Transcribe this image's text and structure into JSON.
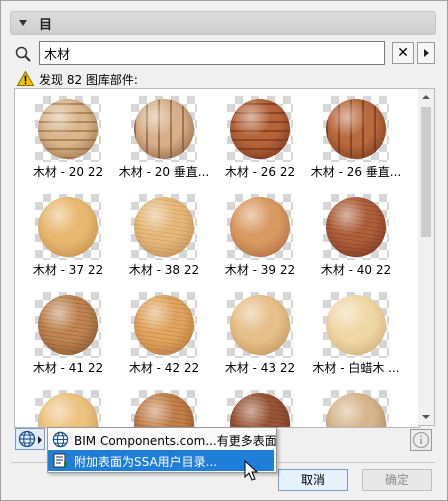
{
  "section": {
    "title": "目"
  },
  "search": {
    "value": "木材",
    "clear_label": "✕"
  },
  "status": {
    "text": "发现 82 图库部件:"
  },
  "gallery": {
    "items": [
      {
        "label": "木材 - 20 22",
        "color": "#d9b68c",
        "dark": "#8a5a32",
        "pattern": "hbands"
      },
      {
        "label": "木材 - 20 垂直...",
        "color": "#d6b089",
        "dark": "#7a4e2c",
        "pattern": "vbands"
      },
      {
        "label": "木材 - 26 22",
        "color": "#b5643a",
        "dark": "#6a2a14",
        "pattern": "hbands"
      },
      {
        "label": "木材 - 26 垂直...",
        "color": "#b86a3e",
        "dark": "#6b2d15",
        "pattern": "vbands"
      },
      {
        "label": "木材 - 37 22",
        "color": "#e8b870",
        "dark": "#b78240",
        "pattern": "plain"
      },
      {
        "label": "木材 - 38 22",
        "color": "#e7b97a",
        "dark": "#b5834b",
        "pattern": "fine"
      },
      {
        "label": "木材 - 39 22",
        "color": "#d99a62",
        "dark": "#a0603a",
        "pattern": "plain"
      },
      {
        "label": "木材 - 40 22",
        "color": "#b0603a",
        "dark": "#6e2d18",
        "pattern": "fine"
      },
      {
        "label": "木材 - 41 22",
        "color": "#c08552",
        "dark": "#7a4a28",
        "pattern": "fine"
      },
      {
        "label": "木材 - 42 22",
        "color": "#e2a660",
        "dark": "#a86a30",
        "pattern": "fine"
      },
      {
        "label": "木材 - 43 22",
        "color": "#e6c08a",
        "dark": "#b8884e",
        "pattern": "plain"
      },
      {
        "label": "木材 - 白蜡木 ...",
        "color": "#f0d7a6",
        "dark": "#c4a06a",
        "pattern": "plain"
      },
      {
        "label": "",
        "color": "#ecc27e",
        "dark": "#bb8a48",
        "pattern": "plain"
      },
      {
        "label": "",
        "color": "#c3824c",
        "dark": "#7a4322",
        "pattern": "fine"
      },
      {
        "label": "",
        "color": "#9a5636",
        "dark": "#5c2a16",
        "pattern": "fine"
      },
      {
        "label": "",
        "color": "#d6b48c",
        "dark": "#9a7650",
        "pattern": "plain"
      }
    ]
  },
  "menu": {
    "items": [
      {
        "label": "BIM Components.com...有更多表面"
      },
      {
        "label": "附加表面为SSA用户目录..."
      }
    ]
  },
  "buttons": {
    "cancel": "取消",
    "ok": "确定"
  },
  "colors": {
    "accent": "#1f7fd8",
    "warning": "#f5c400"
  }
}
